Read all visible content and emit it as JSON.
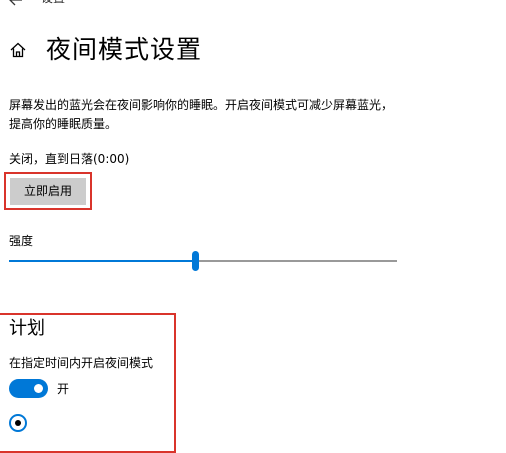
{
  "titlebar": {
    "back_icon": "back-arrow-icon",
    "label": "设置"
  },
  "header": {
    "home_icon": "home-icon",
    "title": "夜间模式设置"
  },
  "description": "屏幕发出的蓝光会在夜间影响你的睡眠。开启夜间模式可减少屏幕蓝光，提高你的睡眠质量。",
  "status": "关闭，直到日落(0:00)",
  "enable_button": "立即启用",
  "strength": {
    "label": "强度",
    "value_percent": 48
  },
  "schedule": {
    "title": "计划",
    "toggle_label": "在指定时间内开启夜间模式",
    "toggle_on": true,
    "toggle_state": "开",
    "radio_selected": true
  },
  "colors": {
    "accent": "#0078d7",
    "highlight": "#d9342b",
    "button_bg": "#cccccc",
    "track_rest": "#999999"
  }
}
